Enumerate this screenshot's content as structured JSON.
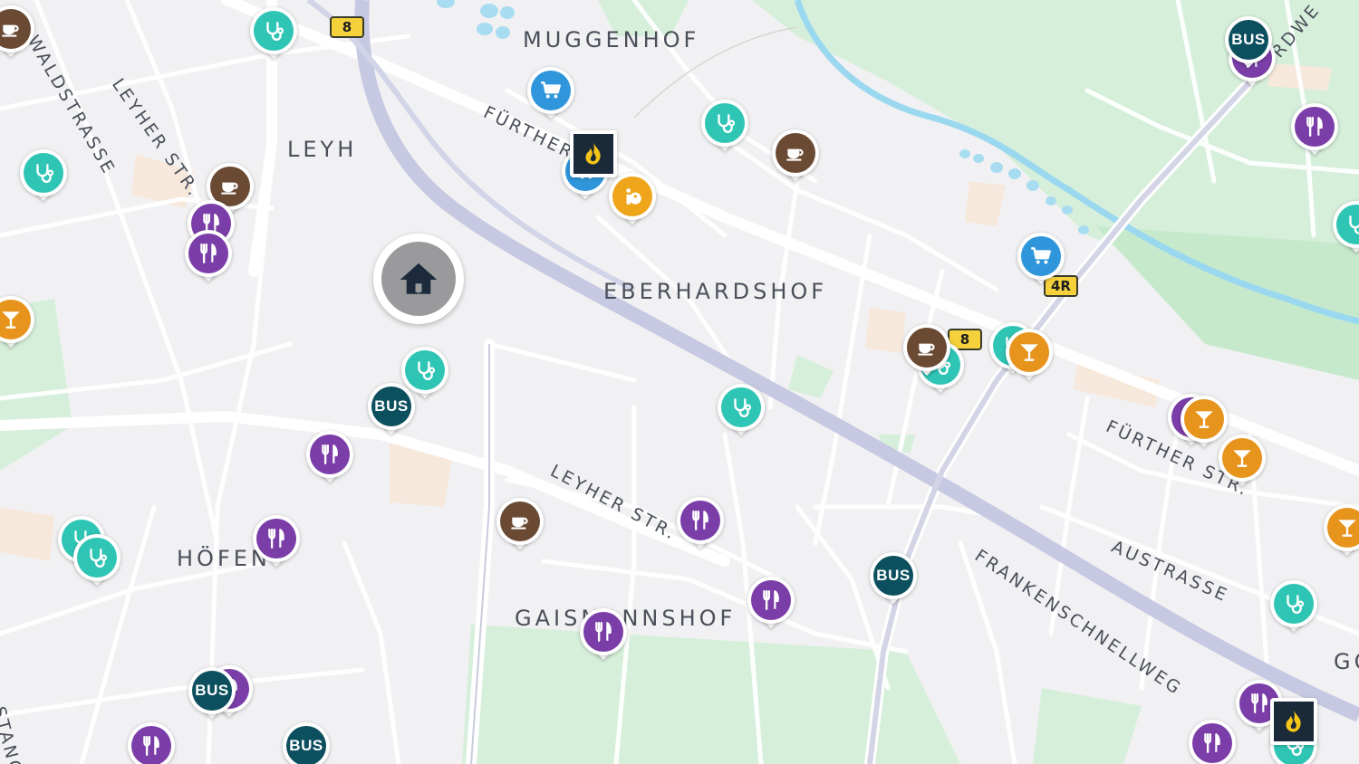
{
  "colors": {
    "health": "#2fc5b5",
    "cafe": "#6b4a34",
    "restaurant": "#7b3ea8",
    "shopping": "#2f96db",
    "bar": "#e7941c",
    "sights": "#efa51a",
    "bus": "#0c4f5e",
    "fuel": "#1b2a38",
    "home": "#9a9a9c",
    "water": "#8ed1ec",
    "park": "#cdebd2",
    "rail": "#c8cae0"
  },
  "labels": {
    "districts": [
      {
        "id": "muggenhof",
        "text": "MUGGENHOF"
      },
      {
        "id": "leyh",
        "text": "LEYH"
      },
      {
        "id": "eberhardshof",
        "text": "EBERHARDSHOF"
      },
      {
        "id": "hoefen",
        "text": "HÖFEN"
      },
      {
        "id": "gaismannshof",
        "text": "GAISMANNSHOF"
      },
      {
        "id": "go-edge",
        "text": "GO"
      }
    ],
    "streets": [
      {
        "id": "waldstrasse",
        "text": "WALDSTRASSE"
      },
      {
        "id": "leyher-str-north",
        "text": "LEYHER STR."
      },
      {
        "id": "fuerther-str-west",
        "text": "FÜRTHER"
      },
      {
        "id": "leyher-str-south",
        "text": "LEYHER STR."
      },
      {
        "id": "fuerther-str-east",
        "text": "FÜRTHER STR."
      },
      {
        "id": "austrasse",
        "text": "AUSTRASSE"
      },
      {
        "id": "frankenschnellweg",
        "text": "FRANKENSCHNELLWEG"
      },
      {
        "id": "nordwest-edge",
        "text": "RDWE"
      },
      {
        "id": "west-edge-street",
        "text": "STANG"
      }
    ],
    "road_shields": [
      "8",
      "8",
      "4R"
    ]
  },
  "pois": {
    "home": {
      "icon": "house-icon"
    },
    "bus_label": "BUS",
    "icons": {
      "health": "stethoscope-icon",
      "cafe": "coffee-cup-icon",
      "restaurant": "fork-knife-icon",
      "shopping": "shopping-cart-icon",
      "bar": "cocktail-glass-icon",
      "sights": "sights-icon",
      "fuel": "fuel-flame-icon"
    }
  }
}
